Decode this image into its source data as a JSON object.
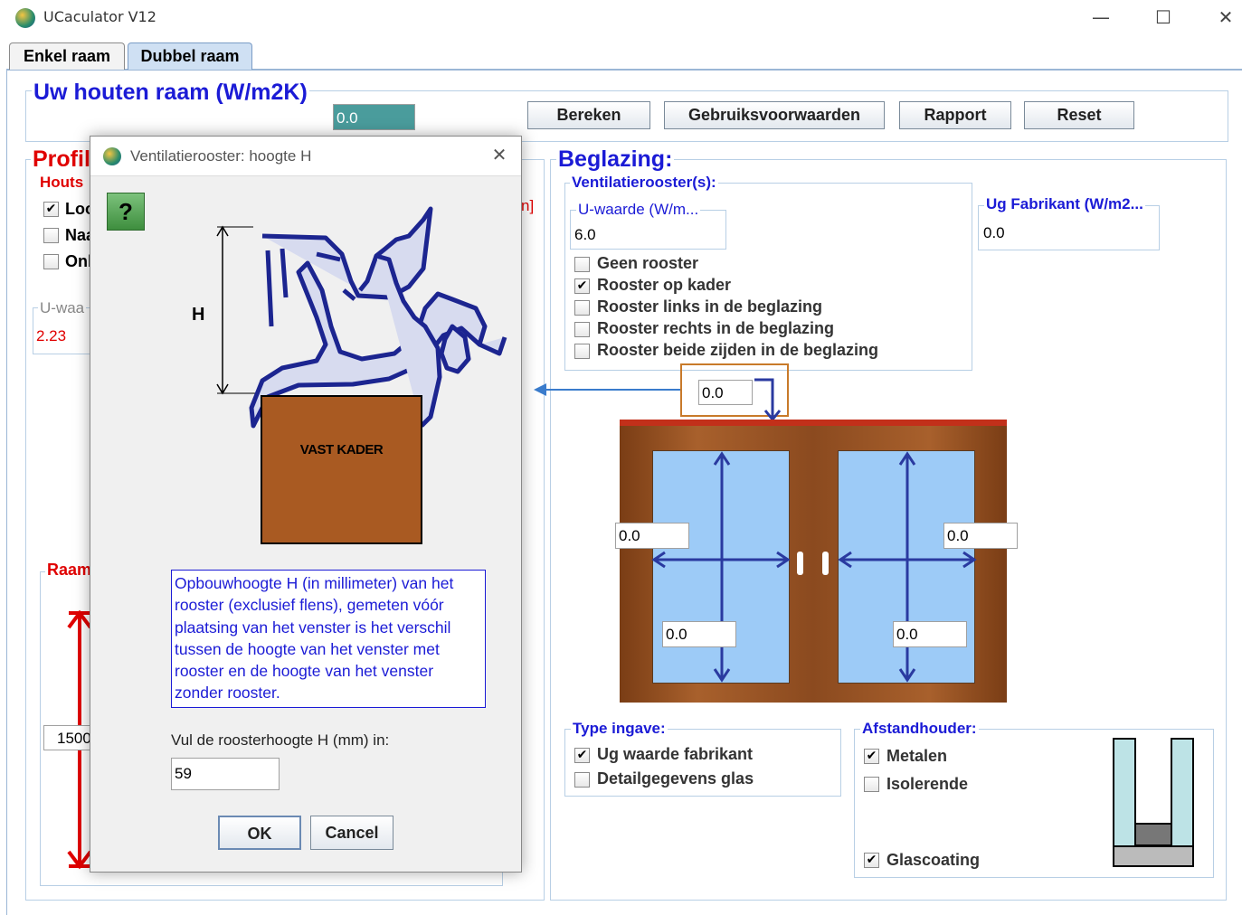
{
  "app": {
    "title": "UCaculator V12",
    "minimize": "—",
    "maximize": "☐",
    "close": "✕"
  },
  "tabs": [
    {
      "label": "Enkel raam",
      "active": false
    },
    {
      "label": "Dubbel raam",
      "active": true
    }
  ],
  "result": {
    "legend": "Uw houten raam (W/m2K)",
    "value": "0.0"
  },
  "toolbar": {
    "bereken": "Bereken",
    "gebruiksvoorwaarden": "Gebruiksvoorwaarden",
    "rapport": "Rapport",
    "reset": "Reset"
  },
  "profiel": {
    "legend": "Profil",
    "houtsoort": "Houts",
    "options": [
      "Loo",
      "Naa",
      "Onb"
    ],
    "checked": [
      true,
      false,
      false
    ],
    "uwaarde_legend": "U-waa",
    "uwaarde": "2.23",
    "trunc_bracket": "n]"
  },
  "raam": {
    "legend": "Raam",
    "hoogte": "1500"
  },
  "beglazing": {
    "legend": "Beglazing:",
    "vent_legend": "Ventilatierooster(s):",
    "uwaarde_legend": "U-waarde (W/m...",
    "uwaarde": "6.0",
    "options": [
      "Geen rooster",
      "Rooster op kader",
      "Rooster links in de beglazing",
      "Rooster rechts in de beglazing",
      "Rooster beide zijden in de beglazing"
    ],
    "checked": [
      false,
      true,
      false,
      false,
      false
    ],
    "ug_legend": "Ug Fabrikant (W/m2...",
    "ug": "0.0",
    "rooster_h": "0.0",
    "left_width": "0.0",
    "right_width": "0.0",
    "left_height": "0.0",
    "right_height": "0.0"
  },
  "type_ingave": {
    "legend": "Type ingave:",
    "options": [
      "Ug waarde fabrikant",
      "Detailgegevens glas"
    ],
    "checked": [
      true,
      false
    ]
  },
  "afstandhouder": {
    "legend": "Afstandhouder:",
    "options": [
      "Metalen",
      "Isolerende"
    ],
    "checked": [
      true,
      false
    ],
    "coating": "Glascoating",
    "coating_checked": true
  },
  "dialog": {
    "title": "Ventilatierooster: hoogte H",
    "close": "✕",
    "help": "?",
    "h_label": "H",
    "kader_label": "VAST KADER",
    "description": "Opbouwhoogte H (in millimeter) van het rooster (exclusief flens), gemeten vóór plaatsing van het venster is het verschil tussen de hoogte van het venster met rooster en de hoogte van het venster zonder rooster.",
    "prompt": "Vul de roosterhoogte H (mm) in:",
    "value": "59",
    "ok": "OK",
    "cancel": "Cancel"
  },
  "colors": {
    "accent": "#1b1bd6",
    "red": "#e00000",
    "wood": "#8b4a1f",
    "glass": "#9dcbf7",
    "teal": "#4a9c9c"
  }
}
